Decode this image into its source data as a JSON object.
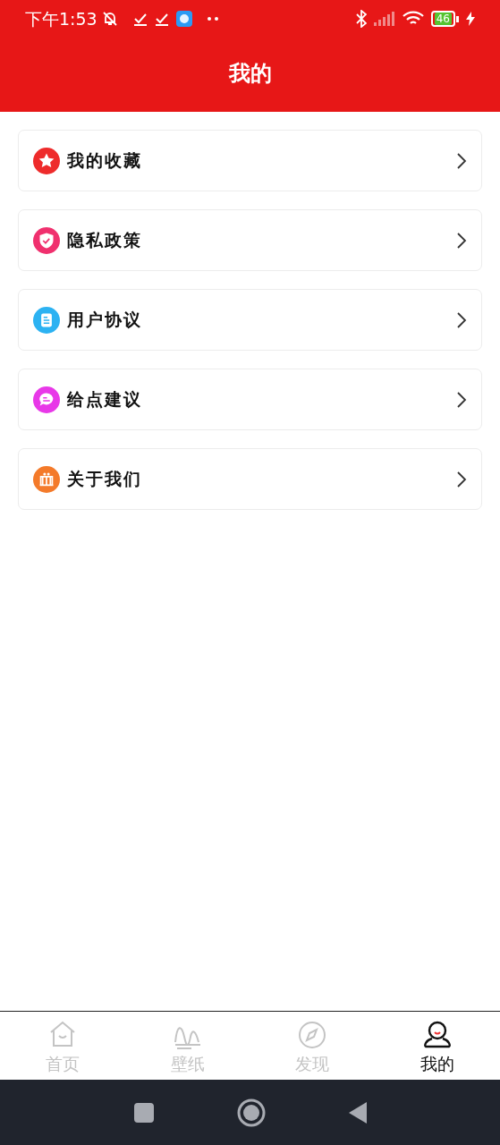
{
  "status_bar": {
    "time": "下午1:53",
    "battery": "46"
  },
  "header": {
    "title": "我的"
  },
  "menu": [
    {
      "label": "我的收藏",
      "kind": "star",
      "color": "#ee2b2b"
    },
    {
      "label": "隐私政策",
      "kind": "shield",
      "color": "#f0306e"
    },
    {
      "label": "用户协议",
      "kind": "document",
      "color": "#2cb2f2"
    },
    {
      "label": "给点建议",
      "kind": "chat",
      "color": "#e838e8"
    },
    {
      "label": "关于我们",
      "kind": "people",
      "color": "#f47a2a"
    }
  ],
  "tabs": [
    {
      "label": "首页",
      "kind": "home",
      "selected": false
    },
    {
      "label": "壁纸",
      "kind": "wave",
      "selected": false
    },
    {
      "label": "发现",
      "kind": "compass",
      "selected": false
    },
    {
      "label": "我的",
      "kind": "person",
      "selected": true
    }
  ]
}
